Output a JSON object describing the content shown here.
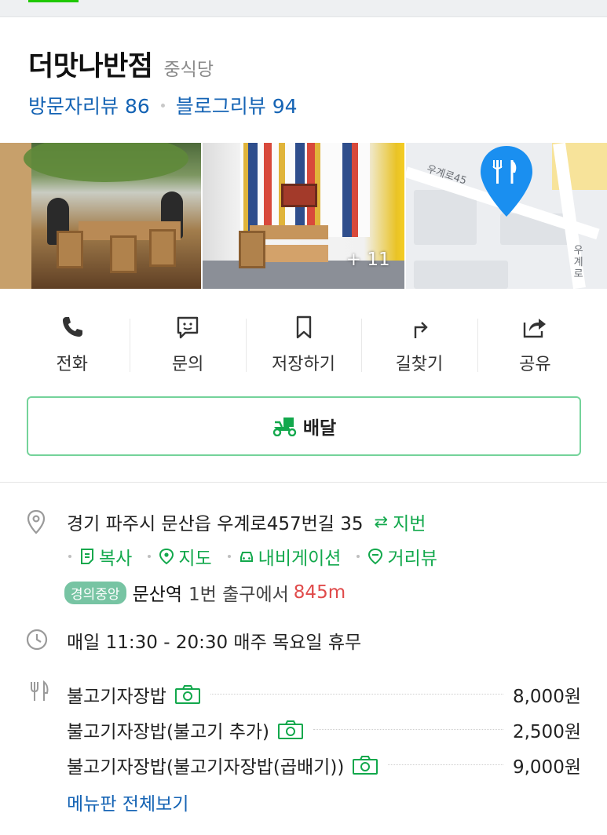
{
  "place": {
    "name": "더맛나반점",
    "category": "중식당"
  },
  "reviews": {
    "visitor": "방문자리뷰 86",
    "blog": "블로그리뷰 94"
  },
  "photos": {
    "more_count": "+ 11",
    "map_road_label": "우계로45",
    "map_road_label_vertical": "우계로"
  },
  "actions": [
    {
      "label": "전화",
      "icon": "phone-icon"
    },
    {
      "label": "문의",
      "icon": "chat-icon"
    },
    {
      "label": "저장하기",
      "icon": "bookmark-icon"
    },
    {
      "label": "길찾기",
      "icon": "directions-icon"
    },
    {
      "label": "공유",
      "icon": "share-icon"
    }
  ],
  "delivery": {
    "label": "배달",
    "icon": "delivery-scooter-icon"
  },
  "address": {
    "road": "경기 파주시 문산읍 우계로457번길 35",
    "jibun_label": "지번",
    "copy_label": "복사",
    "map_label": "지도",
    "navigation_label": "내비게이션",
    "streetview_label": "거리뷰"
  },
  "subway": {
    "line": "경의중앙",
    "station": "문산역",
    "exit": "1번 출구에서",
    "distance": "845m"
  },
  "hours": {
    "text": "매일 11:30 - 20:30 매주 목요일 휴무"
  },
  "menu": {
    "items": [
      {
        "name": "불고기자장밥",
        "price": "8,000원"
      },
      {
        "name": "불고기자장밥(불고기 추가)",
        "price": "2,500원"
      },
      {
        "name": "불고기자장밥(불고기자장밥(곱배기))",
        "price": "9,000원"
      }
    ],
    "view_all_label": "메뉴판 전체보기"
  },
  "colors": {
    "green": "#12a84c",
    "blue": "#1463b4",
    "red": "#e04b4b",
    "pin": "#1a8ff0",
    "subway_badge": "#77c4a3"
  }
}
